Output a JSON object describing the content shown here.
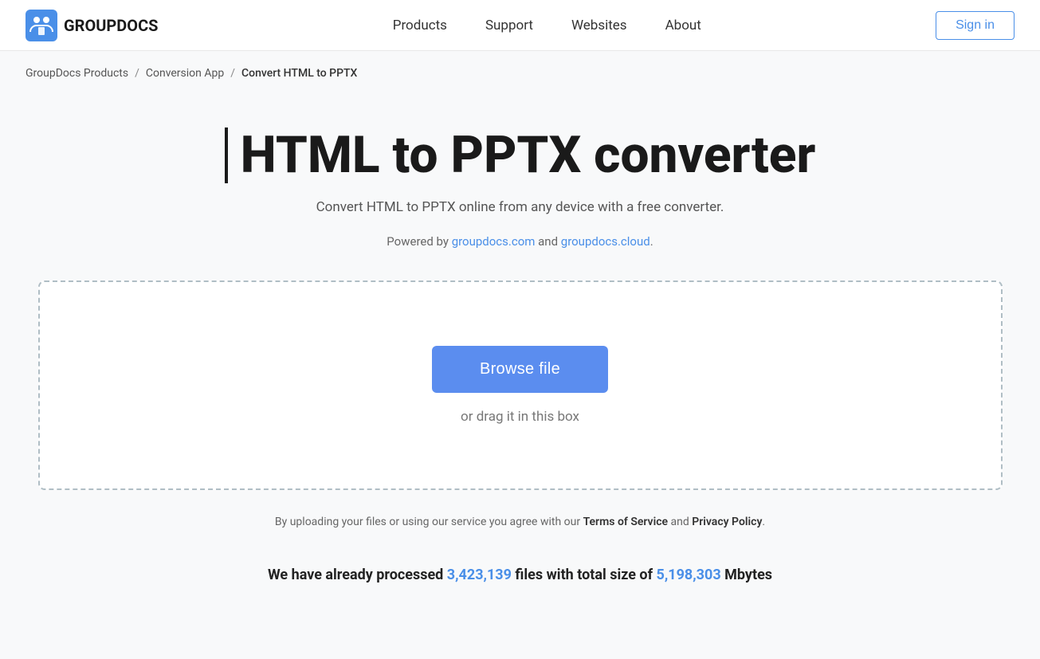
{
  "header": {
    "logo_text": "GROUPDOCS",
    "nav": {
      "items": [
        {
          "label": "Products",
          "href": "#"
        },
        {
          "label": "Support",
          "href": "#"
        },
        {
          "label": "Websites",
          "href": "#"
        },
        {
          "label": "About",
          "href": "#"
        }
      ],
      "signin_label": "Sign in"
    }
  },
  "breadcrumb": {
    "items": [
      {
        "label": "GroupDocs Products",
        "href": "#"
      },
      {
        "label": "Conversion App",
        "href": "#"
      },
      {
        "label": "Convert HTML to PPTX",
        "href": null
      }
    ],
    "separator": "/"
  },
  "hero": {
    "title": "HTML to PPTX converter",
    "subtitle": "Convert HTML to PPTX online from any device with a free converter.",
    "powered_by_text": "Powered by ",
    "powered_by_link1_text": "groupdocs.com",
    "powered_by_link1_href": "#",
    "powered_by_and": " and ",
    "powered_by_link2_text": "groupdocs.cloud",
    "powered_by_link2_href": "#",
    "powered_by_end": "."
  },
  "upload": {
    "browse_label": "Browse file",
    "drag_text": "or drag it in this box"
  },
  "terms": {
    "prefix": "By uploading your files or using our service you agree with our ",
    "tos_label": "Terms of Service",
    "and": " and ",
    "privacy_label": "Privacy Policy",
    "suffix": "."
  },
  "stats": {
    "prefix": "We have already processed ",
    "files_count": "3,423,139",
    "middle": " files with total size of ",
    "size_count": "5,198,303",
    "suffix": " Mbytes"
  }
}
